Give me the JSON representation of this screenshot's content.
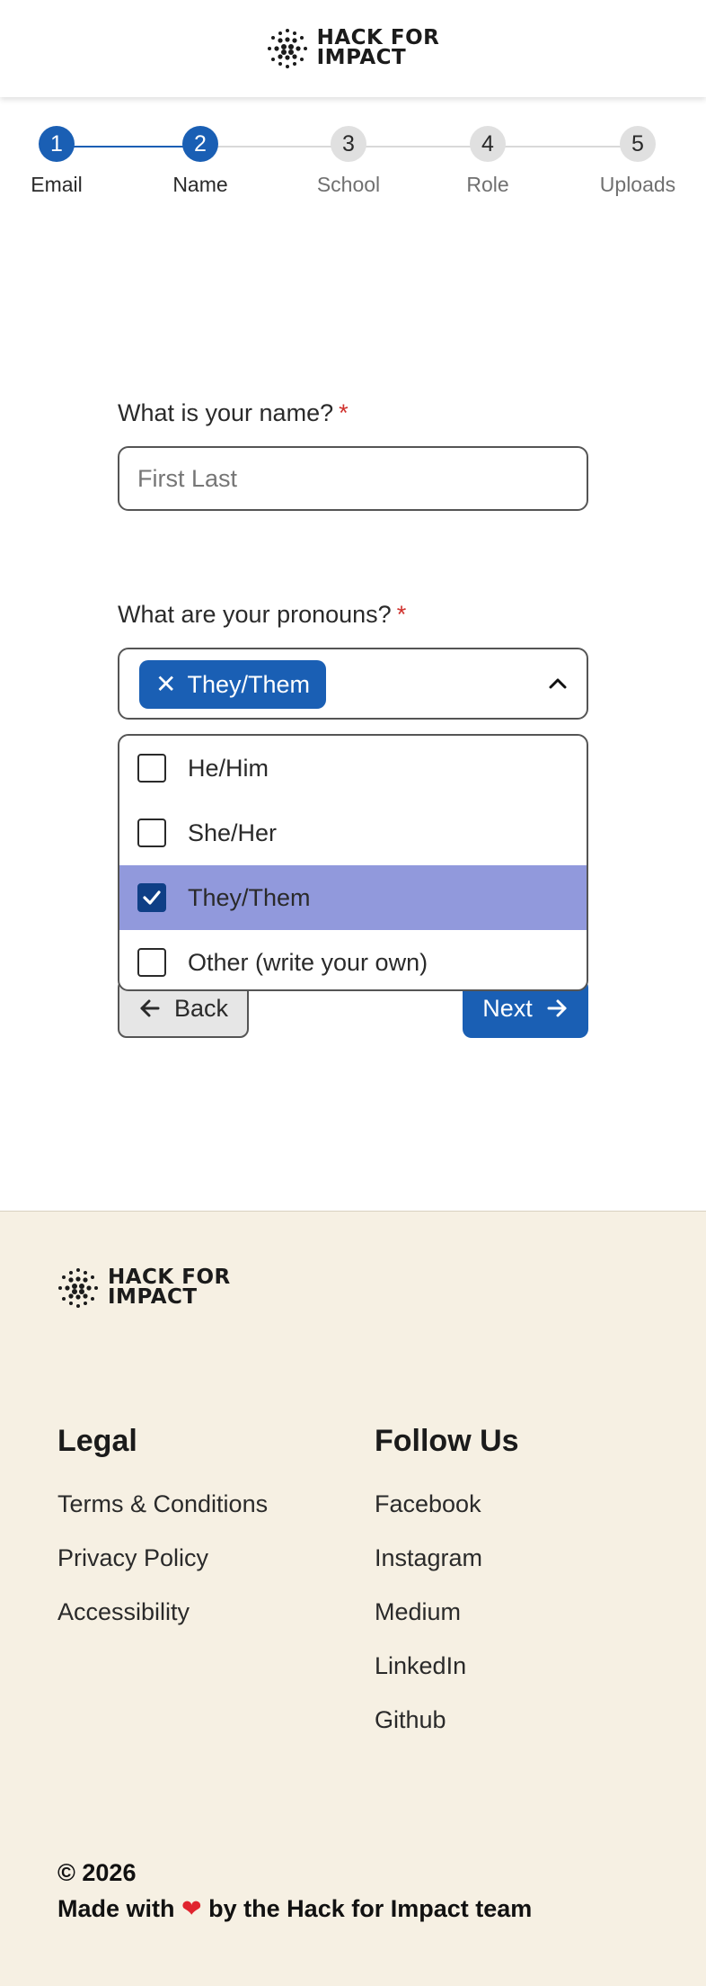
{
  "header": {
    "logo_text_line1": "HACK FOR",
    "logo_text_line2": "IMPACT"
  },
  "stepper": {
    "steps": [
      {
        "number": "1",
        "label": "Email",
        "state": "done"
      },
      {
        "number": "2",
        "label": "Name",
        "state": "current"
      },
      {
        "number": "3",
        "label": "School",
        "state": "todo"
      },
      {
        "number": "4",
        "label": "Role",
        "state": "todo"
      },
      {
        "number": "5",
        "label": "Uploads",
        "state": "todo"
      }
    ]
  },
  "form": {
    "name_label": "What is your name?",
    "name_required": "*",
    "name_placeholder": "First Last",
    "name_value": "",
    "pronouns_label": "What are your pronouns?",
    "pronouns_required": "*",
    "selected_chip": "They/Them",
    "options": [
      {
        "label": "He/Him",
        "checked": false
      },
      {
        "label": "She/Her",
        "checked": false
      },
      {
        "label": "They/Them",
        "checked": true
      },
      {
        "label": "Other (write your own)",
        "checked": false
      }
    ],
    "back_label": "Back",
    "next_label": "Next"
  },
  "footer": {
    "logo_text_line1": "HACK FOR",
    "logo_text_line2": "IMPACT",
    "legal_title": "Legal",
    "legal_links": [
      "Terms & Conditions",
      "Privacy Policy",
      "Accessibility"
    ],
    "follow_title": "Follow Us",
    "follow_links": [
      "Facebook",
      "Instagram",
      "Medium",
      "LinkedIn",
      "Github"
    ],
    "copyright": "© 2026",
    "made_with_prefix": "Made with",
    "made_with_suffix": "by the Hack for Impact team"
  },
  "colors": {
    "primary": "#1a5fb4",
    "selected_option": "#9199dc",
    "checkbox_checked": "#0f3f86",
    "footer_bg": "#f6f0e3",
    "required": "#d0312d"
  }
}
